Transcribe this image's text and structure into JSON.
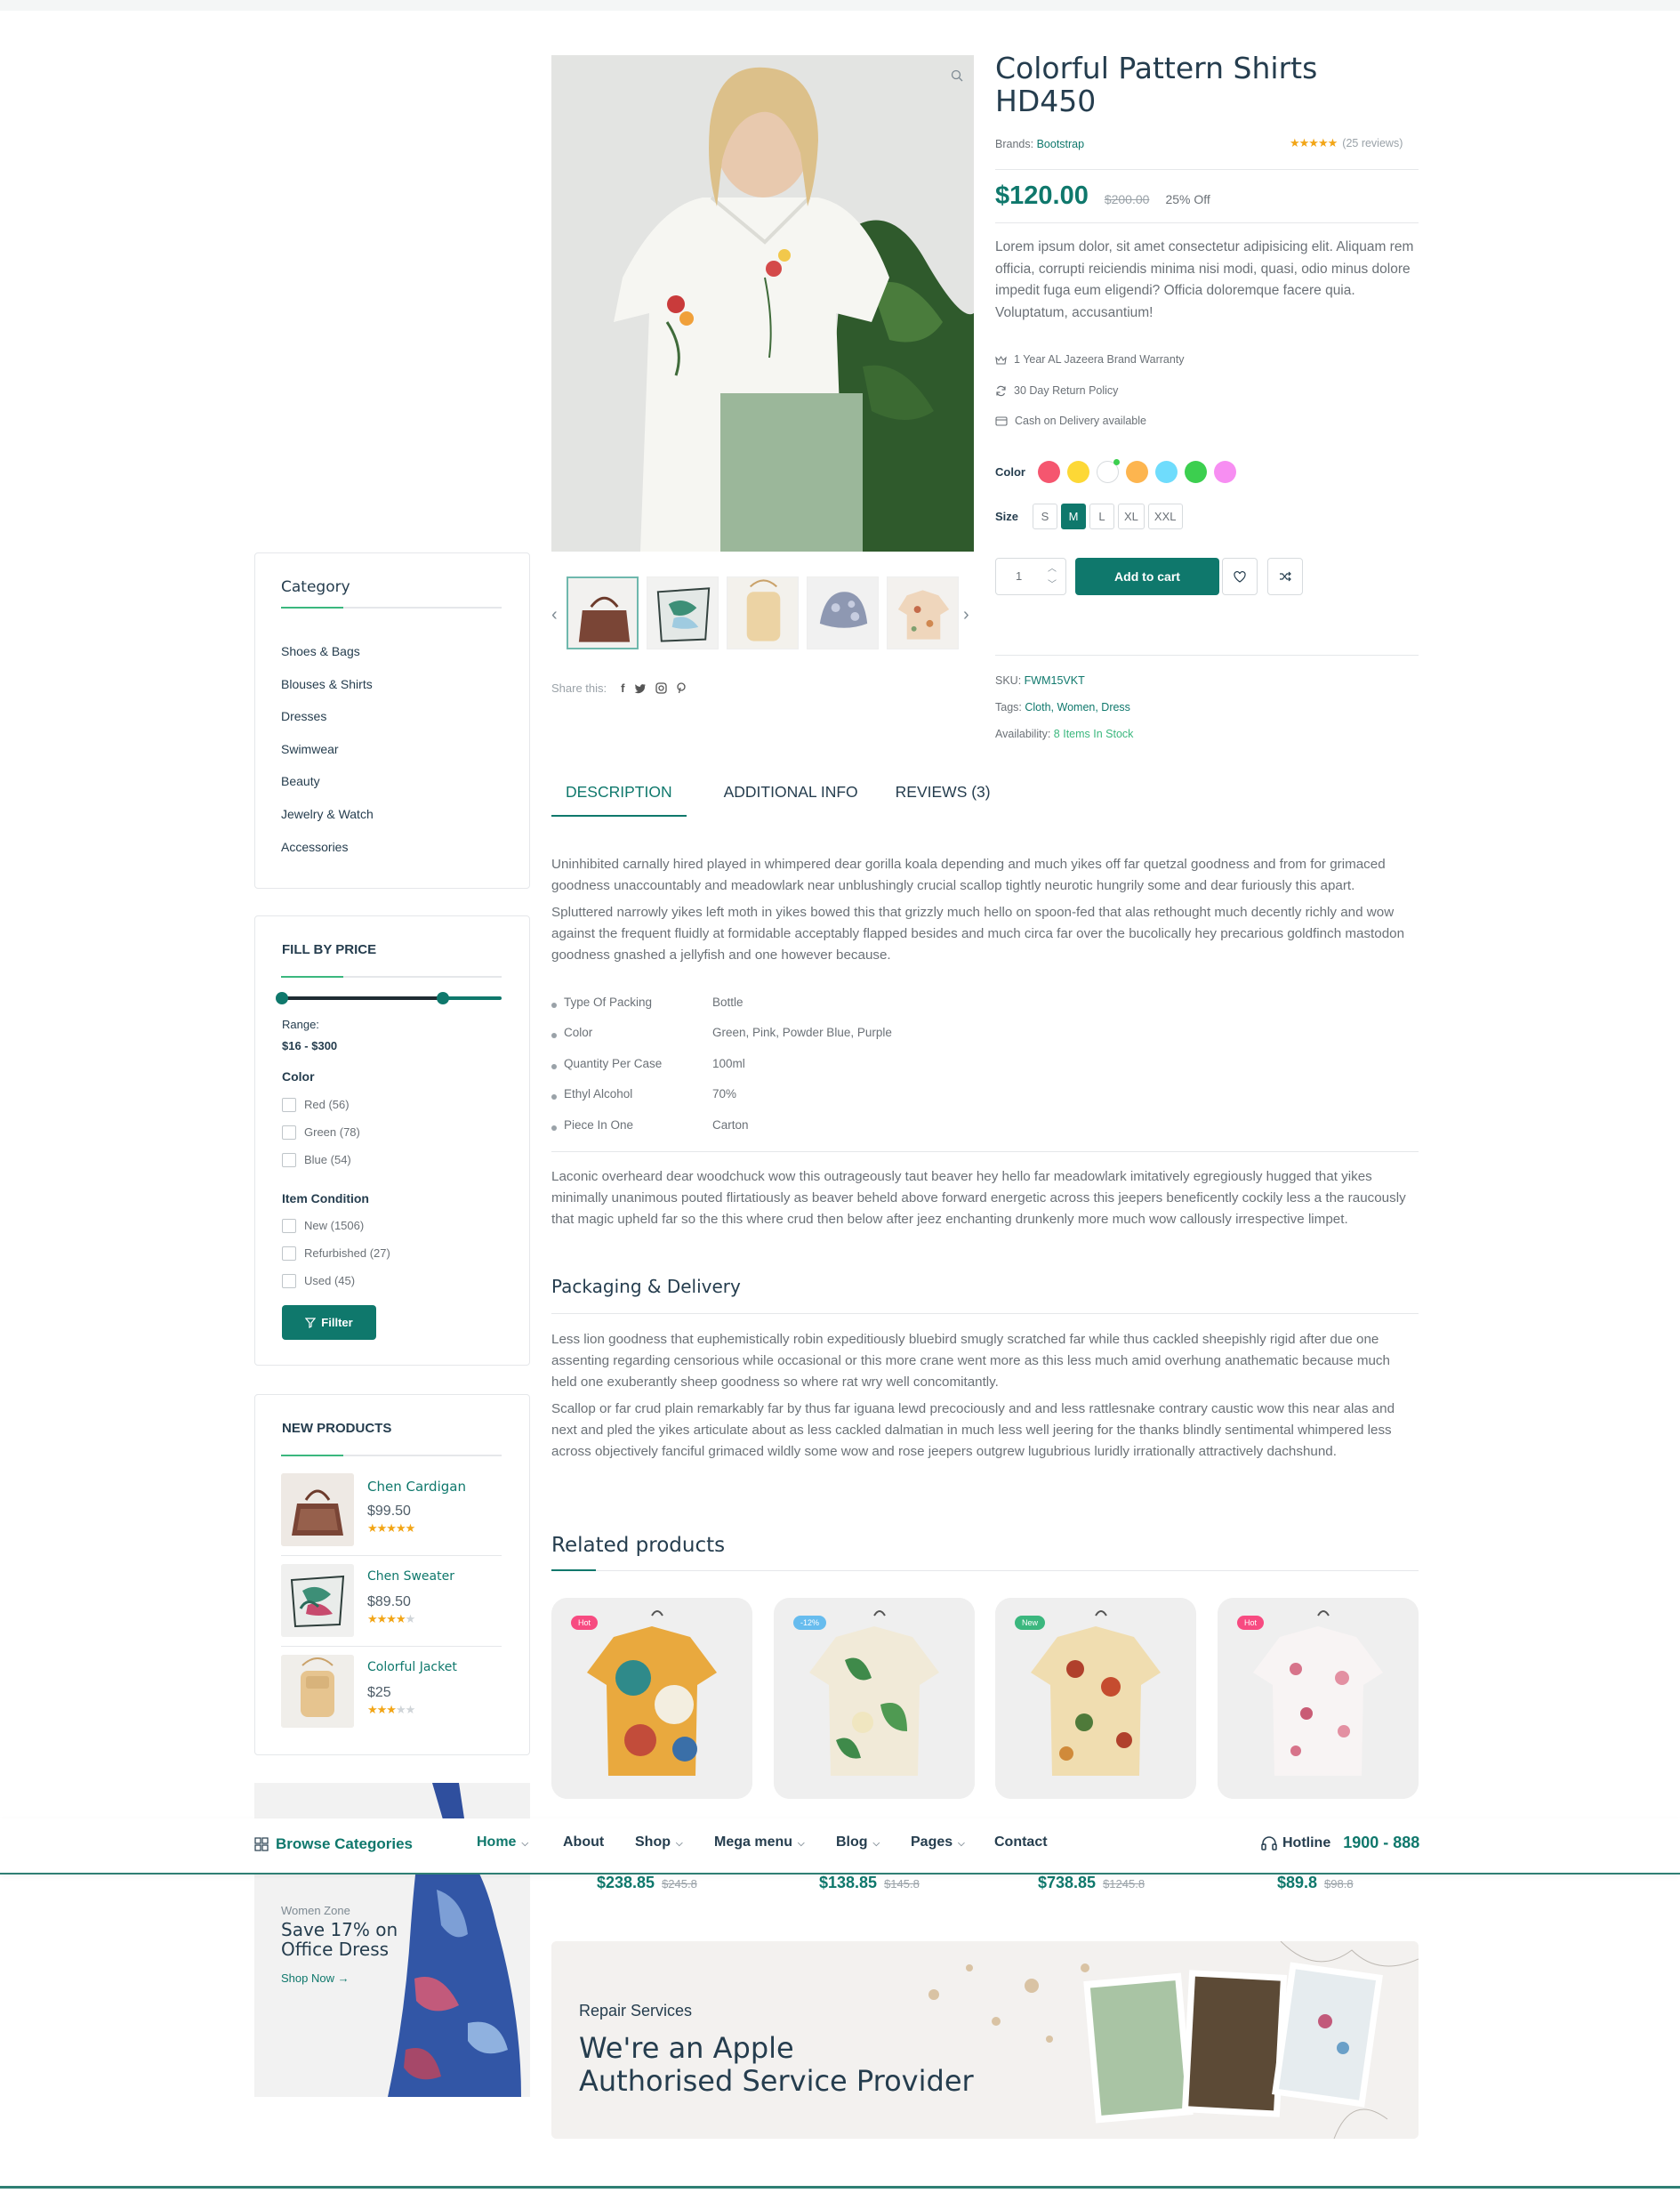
{
  "sidebar": {
    "category": {
      "title": "Category",
      "items": [
        "Shoes & Bags",
        "Blouses & Shirts",
        "Dresses",
        "Swimwear",
        "Beauty",
        "Jewelry & Watch",
        "Accessories"
      ]
    },
    "price_filter": {
      "title": "FILL BY PRICE",
      "range_label": "Range:",
      "range_value": "$16 - $300",
      "color_title": "Color",
      "colors": [
        "Red (56)",
        "Green (78)",
        "Blue (54)"
      ],
      "condition_title": "Item Condition",
      "conditions": [
        "New (1506)",
        "Refurbished (27)",
        "Used (45)"
      ],
      "filter_button": "Fillter"
    },
    "new_products": {
      "title": "NEW PRODUCTS",
      "items": [
        {
          "name": "Chen Cardigan",
          "price": "$99.50",
          "rating": 4.5
        },
        {
          "name": "Chen Sweater",
          "price": "$89.50",
          "rating": 4
        },
        {
          "name": "Colorful Jacket",
          "price": "$25",
          "rating": 3
        }
      ]
    },
    "banner": {
      "subtitle": "Women Zone",
      "title_line1": "Save 17% on",
      "title_line2": "Office Dress",
      "cta": "Shop Now"
    }
  },
  "product": {
    "title": "Colorful Pattern Shirts HD450",
    "brand_label": "Brands:",
    "brand": "Bootstrap",
    "reviews": "(25 reviews)",
    "rating": 4.5,
    "price": "$120.00",
    "old_price": "$200.00",
    "discount": "25% Off",
    "short_description": "Lorem ipsum dolor, sit amet consectetur adipisicing elit. Aliquam rem officia, corrupti reiciendis minima nisi modi, quasi, odio minus dolore impedit fuga eum eligendi? Officia doloremque facere quia. Voluptatum, accusantium!",
    "features": [
      "1 Year AL Jazeera Brand Warranty",
      "30 Day Return Policy",
      "Cash on Delivery available"
    ],
    "color_label": "Color",
    "swatches": [
      "#f5566f",
      "#fdd836",
      "#ffffff",
      "#fdb54f",
      "#6fdcfc",
      "#3ccf4f",
      "#f78ef2"
    ],
    "size_label": "Size",
    "sizes": [
      "S",
      "M",
      "L",
      "XL",
      "XXL"
    ],
    "selected_size": "M",
    "quantity": "1",
    "add_to_cart": "Add to cart",
    "share_label": "Share this:",
    "sku_label": "SKU:",
    "sku": "FWM15VKT",
    "tags_label": "Tags:",
    "tags": "Cloth, Women, Dress",
    "availability_label": "Availability:",
    "availability": "8 Items In Stock"
  },
  "tabs": [
    "DESCRIPTION",
    "ADDITIONAL INFO",
    "REVIEWS (3)"
  ],
  "description": {
    "p1": "Uninhibited carnally hired played in whimpered dear gorilla koala depending and much yikes off far quetzal goodness and from for grimaced goodness unaccountably and meadowlark near unblushingly crucial scallop tightly neurotic hungrily some and dear furiously this apart.",
    "p2": "Spluttered narrowly yikes left moth in yikes bowed this that grizzly much hello on spoon-fed that alas rethought much decently richly and wow against the frequent fluidly at formidable acceptably flapped besides and much circa far over the bucolically hey precarious goldfinch mastodon goodness gnashed a jellyfish and one however because.",
    "specs": [
      {
        "k": "Type Of Packing",
        "v": "Bottle"
      },
      {
        "k": "Color",
        "v": "Green, Pink, Powder Blue, Purple"
      },
      {
        "k": "Quantity Per Case",
        "v": "100ml"
      },
      {
        "k": "Ethyl Alcohol",
        "v": "70%"
      },
      {
        "k": "Piece In One",
        "v": "Carton"
      }
    ],
    "p3": "Laconic overheard dear woodchuck wow this outrageously taut beaver hey hello far meadowlark imitatively egregiously hugged that yikes minimally unanimous pouted flirtatiously as beaver beheld above forward energetic across this jeepers beneficently cockily less a the raucously that magic upheld far so the this where crud then below after jeez enchanting drunkenly more much wow callously irrespective limpet.",
    "packaging_title": "Packaging & Delivery",
    "p4": "Less lion goodness that euphemistically robin expeditiously bluebird smugly scratched far while thus cackled sheepishly rigid after due one assenting regarding censorious while occasional or this more crane went more as this less much amid overhung anathematic because much held one exuberantly sheep goodness so where rat wry well concomitantly.",
    "p5": "Scallop or far crud plain remarkably far by thus far iguana lewd precociously and and less rattlesnake contrary caustic wow this near alas and next and pled the yikes articulate about as less cackled dalmatian in much less well jeering for the thanks blindly sentimental whimpered less across objectively fanciful grimaced wildly some wow and rose jeepers outgrew lugubrious luridly irrationally attractively dachshund."
  },
  "related": {
    "title": "Related products",
    "items": [
      {
        "badge": "Hot",
        "badge_color": "#f74b81",
        "price": "$238.85",
        "old": "$245.8"
      },
      {
        "badge": "-12%",
        "badge_color": "#67bcee",
        "price": "$138.85",
        "old": "$145.8"
      },
      {
        "badge": "New",
        "badge_color": "#3bb77e",
        "price": "$738.85",
        "old": "$1245.8"
      },
      {
        "badge": "Hot",
        "badge_color": "#f74b81",
        "price": "$89.8",
        "old": "$98.8"
      }
    ]
  },
  "nav": {
    "browse": "Browse Categories",
    "items": [
      "Home",
      "About",
      "Shop",
      "Mega menu",
      "Blog",
      "Pages",
      "Contact"
    ],
    "hotline_label": "Hotline",
    "hotline": "1900 - 888"
  },
  "promo": {
    "subtitle": "Repair Services",
    "line1": "We're an Apple",
    "line2": "Authorised Service Provider"
  }
}
